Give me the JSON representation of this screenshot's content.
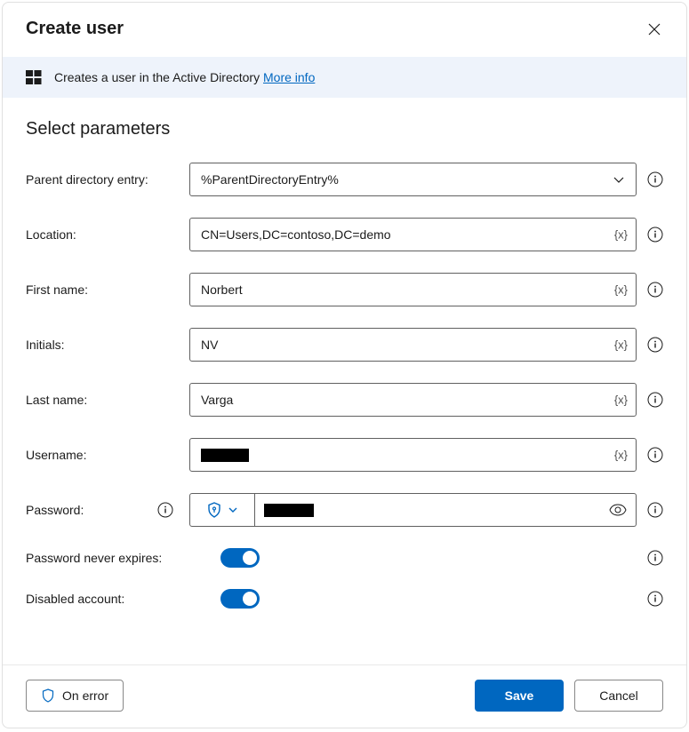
{
  "header": {
    "title": "Create user"
  },
  "banner": {
    "text": "Creates a user in the Active Directory ",
    "link": "More info"
  },
  "section": {
    "title": "Select parameters"
  },
  "labels": {
    "parent": "Parent directory entry:",
    "location": "Location:",
    "first_name": "First name:",
    "initials": "Initials:",
    "last_name": "Last name:",
    "username": "Username:",
    "password": "Password:",
    "never_expires": "Password never expires:",
    "disabled": "Disabled account:"
  },
  "values": {
    "parent": "%ParentDirectoryEntry%",
    "location": "CN=Users,DC=contoso,DC=demo",
    "first_name": "Norbert",
    "initials": "NV",
    "last_name": "Varga",
    "username_redacted": true,
    "password_redacted": true,
    "never_expires": true,
    "disabled": true
  },
  "var_token": "{x}",
  "footer": {
    "on_error": "On error",
    "save": "Save",
    "cancel": "Cancel"
  }
}
